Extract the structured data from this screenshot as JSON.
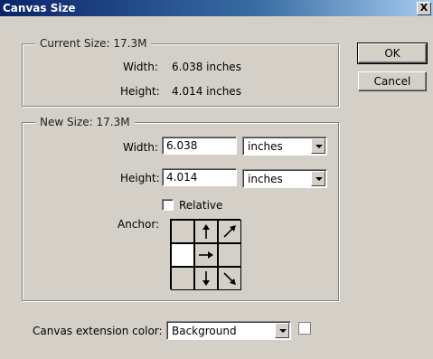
{
  "window": {
    "title": "Canvas Size",
    "close_glyph": "X"
  },
  "current_size": {
    "label": "Current Size: 17.3M",
    "width_label": "Width:",
    "width_value": "6.038 inches",
    "height_label": "Height:",
    "height_value": "4.014 inches"
  },
  "new_size": {
    "label": "New Size: 17.3M",
    "width_label": "Width:",
    "width_value": "6.038",
    "width_unit": "inches",
    "height_label": "Height:",
    "height_value": "4.014",
    "height_unit": "inches",
    "relative_label": "Relative",
    "relative_checked": false,
    "anchor_label": "Anchor:",
    "anchor_selected": "middle-left"
  },
  "buttons": {
    "ok": "OK",
    "cancel": "Cancel"
  },
  "extension": {
    "label": "Canvas extension color:",
    "value": "Background",
    "swatch_color": "#ffffff"
  }
}
